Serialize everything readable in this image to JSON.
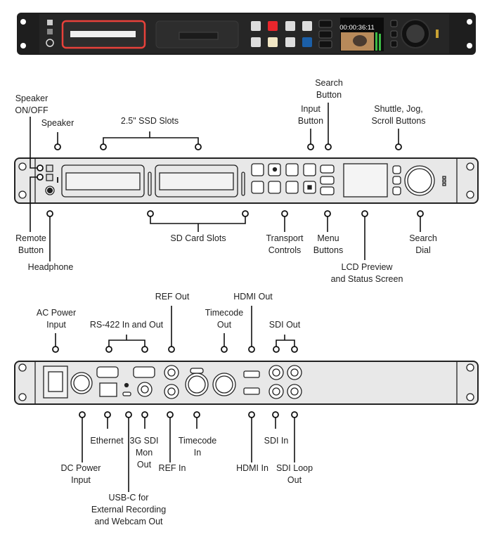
{
  "photo": {
    "lcd_timecode": "00:00:36:11",
    "highlight_color": "#e8413a",
    "rec_color": "#e8262c",
    "play_color": "#f1e6c4",
    "stop_color": "#1b5fa8"
  },
  "front_labels": {
    "speaker_onoff": [
      "Speaker",
      "ON/OFF"
    ],
    "speaker": [
      "Speaker"
    ],
    "ssd_slots": [
      "2.5\" SSD Slots"
    ],
    "input_button": [
      "Input",
      "Button"
    ],
    "search_button": [
      "Search",
      "Button"
    ],
    "shuttle_jog_scroll": [
      "Shuttle, Jog,",
      "Scroll Buttons"
    ],
    "remote_button": [
      "Remote",
      "Button"
    ],
    "headphone": [
      "Headphone"
    ],
    "sd_card_slots": [
      "SD Card Slots"
    ],
    "transport_controls": [
      "Transport",
      "Controls"
    ],
    "menu_buttons": [
      "Menu",
      "Buttons"
    ],
    "lcd_preview": [
      "LCD Preview",
      "and Status Screen"
    ],
    "search_dial": [
      "Search",
      "Dial"
    ]
  },
  "rear_labels": {
    "ac_power": [
      "AC Power",
      "Input"
    ],
    "rs422": [
      "RS-422 In and Out"
    ],
    "ref_out": [
      "REF Out"
    ],
    "timecode_out": [
      "Timecode",
      "Out"
    ],
    "hdmi_out": [
      "HDMI Out"
    ],
    "sdi_out": [
      "SDI Out"
    ],
    "ethernet": [
      "Ethernet"
    ],
    "dc_power": [
      "DC Power",
      "Input"
    ],
    "usbc": [
      "USB-C for",
      "External Recording",
      "and Webcam Out"
    ],
    "sdi_mon_out": [
      "3G SDI",
      "Mon",
      "Out"
    ],
    "ref_in": [
      "REF In"
    ],
    "timecode_in": [
      "Timecode",
      "In"
    ],
    "hdmi_in": [
      "HDMI In"
    ],
    "sdi_in": [
      "SDI In"
    ],
    "sdi_loop_out": [
      "SDI Loop",
      "Out"
    ]
  }
}
